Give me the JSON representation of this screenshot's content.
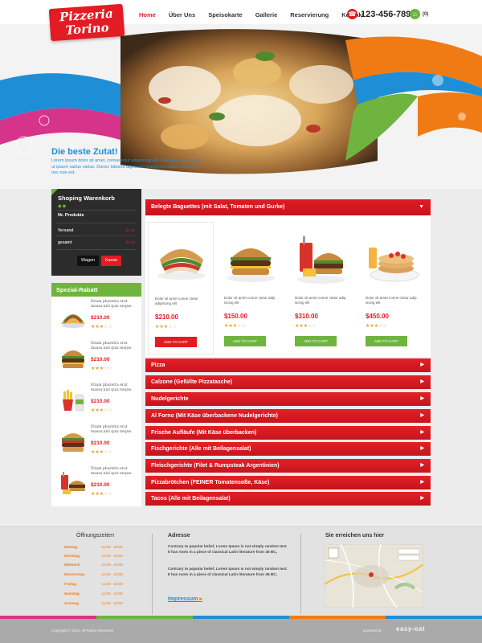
{
  "header": {
    "logo_line1": "Pizzeria",
    "logo_line2": "Torino",
    "nav": [
      "Home",
      "Über Uns",
      "Speisokarte",
      "Gallerie",
      "Reservierung",
      "Kontakt"
    ],
    "phone": "123-456-7890",
    "cart_count": "(0)",
    "phone_icon": "phone-icon",
    "cart_icon": "basket-icon"
  },
  "hero": {
    "title": "Die beste Zutat!",
    "text": "Lorem ipsum dolor sit amet, consectetur adipiscing elit. Praesent viverra est ut ipsum varius varius. Donec lobortis dignissim mauris eu varius. vehicula nec non est."
  },
  "cart": {
    "title": "Shoping Warenkorb",
    "products_label": "Nr. Produkte",
    "shipping_label": "Versand",
    "shipping_value": "$0.00",
    "total_label": "gesamt",
    "total_value": "$0.00",
    "wagen_label": "Wagen",
    "kasse_label": "Kasse"
  },
  "special": {
    "title": "Spezial-Rabatt",
    "items": [
      {
        "text": "Etiam pharetra erat massa nisl quis neque.",
        "price": "$210.00",
        "rating": 3
      },
      {
        "text": "Etiam pharetra erat massa nisl quis neque.",
        "price": "$210.00",
        "rating": 3
      },
      {
        "text": "Etiam pharetra erat massa nisl quis neque.",
        "price": "$210.00",
        "rating": 3
      },
      {
        "text": "Etiam pharetra erat massa nisl quis neque.",
        "price": "$210.00",
        "rating": 3
      },
      {
        "text": "Etiam pharetra erat massa nisl quis neque.",
        "price": "$210.00",
        "rating": 3
      }
    ]
  },
  "baguettes": {
    "title": "Belegte Baguettes (mit Salat, Tomaten und Gurke)",
    "products": [
      {
        "text": "Dolor sit amet conne ctetur adipiscing elit",
        "price": "$210.00",
        "rating": 3,
        "button": "ADD TO CART"
      },
      {
        "text": "Dolor sit amet conne ctetur adip iscing elit",
        "price": "$150.00",
        "rating": 3,
        "button": "ADD TO CART"
      },
      {
        "text": "Dolor sit amet conne ctetur adip iscing elit",
        "price": "$310.00",
        "rating": 3,
        "button": "ADD TO CART"
      },
      {
        "text": "Dolor sit amet conne ctetur adip iscing elit",
        "price": "$450.00",
        "rating": 3,
        "button": "ADD TO CART"
      }
    ]
  },
  "categories": [
    "Pizza",
    "Calzone (Gefüllte Pizzatasche)",
    "Nudelgerichte",
    "Al Forno (Mit Käse überbackene Nudelgerichte)",
    "Frische Aufläufe (Mit Käse überbacken)",
    "Fischgerichte (Alle mit Beilagensalat)",
    "Fleischgerichte (Filet & Rumpsteak Argentinien)",
    "Pizzabrötchen (FEINER Tomatensoße, Käse)",
    "Tacos (Alle mit Beilagensalat)"
  ],
  "footer": {
    "hours_title": "Öffnungszeiten",
    "hours": [
      {
        "day": "Montag",
        "time": "- 11:00 - 23:00"
      },
      {
        "day": "Dienstag",
        "time": "- 11:00 - 23:00"
      },
      {
        "day": "Mittwoch",
        "time": "- 11:00 - 23:00"
      },
      {
        "day": "Donnerstag",
        "time": "- 11:00 - 23:00"
      },
      {
        "day": "Freitag",
        "time": "- 11:00 - 23:00"
      },
      {
        "day": "Samstag",
        "time": "- 11:00 - 23:00"
      },
      {
        "day": "Sonntag",
        "time": "- 11:00 - 23:00"
      }
    ],
    "address_title": "Adresse",
    "address_text1": "Contrary to popular belief, Lorem Ipsum is not simply random text. It has roots in a piece of classical Latin literature from 45 BC,",
    "address_text2": "Contrary to popular belief, Lorem Ipsum is not simply random text. It has roots in a piece of classical Latin literature from 45 BC,",
    "impressum": "Impressum",
    "map_title": "Sie erreichen uns hier",
    "copyright": "Copyright © 2014. All Rights Reserved",
    "powered": "powered by",
    "powered_logo": "easy-eat"
  },
  "colors": {
    "brand_red": "#e31b23",
    "brand_green": "#6eb43f",
    "accent_blue": "#1e8fd6",
    "accent_orange": "#f07b14",
    "accent_pink": "#d6338a"
  }
}
